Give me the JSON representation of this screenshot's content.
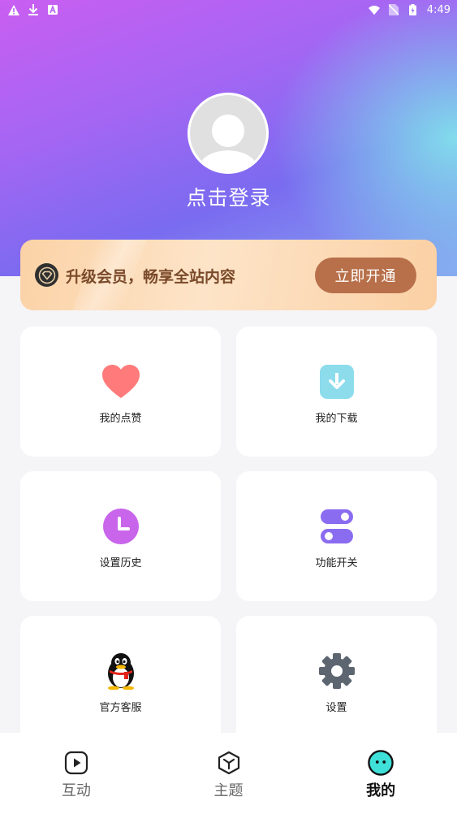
{
  "status_bar": {
    "time": "4:49",
    "left_icons": [
      "warning-icon",
      "download-icon",
      "font-a-icon"
    ],
    "right_icons": [
      "wifi-icon",
      "no-sim-icon",
      "battery-icon"
    ]
  },
  "profile": {
    "login_text": "点击登录"
  },
  "vip": {
    "text": "升级会员，畅享全站内容",
    "button_label": "立即开通"
  },
  "menu": {
    "items": [
      {
        "label": "我的点赞",
        "icon": "heart-icon",
        "color": "#ff7a7a"
      },
      {
        "label": "我的下载",
        "icon": "download-icon",
        "color": "#8cdcec"
      },
      {
        "label": "设置历史",
        "icon": "clock-icon",
        "color": "#c865ea"
      },
      {
        "label": "功能开关",
        "icon": "toggle-icon",
        "color": "#8a6cf0"
      },
      {
        "label": "官方客服",
        "icon": "qq-penguin-icon",
        "color": "#111111"
      },
      {
        "label": "设置",
        "icon": "gear-icon",
        "color": "#5d6670"
      }
    ]
  },
  "tabbar": {
    "tabs": [
      {
        "label": "互动",
        "icon": "play-icon",
        "active": false
      },
      {
        "label": "主题",
        "icon": "cube-icon",
        "active": false
      },
      {
        "label": "我的",
        "icon": "face-icon",
        "active": true
      }
    ]
  },
  "colors": {
    "hero_start": "#c95ef2",
    "hero_end": "#86a8f0",
    "vip_button": "#b8704a",
    "active_tab_icon": "#3ee0d8"
  }
}
